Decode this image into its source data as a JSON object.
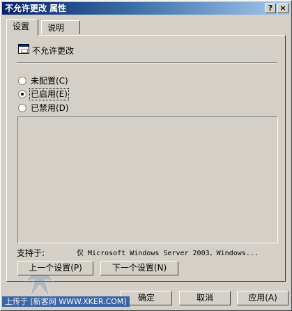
{
  "window": {
    "title": "不允许更改 属性",
    "help_glyph": "?",
    "close_glyph": "×"
  },
  "tabs": [
    {
      "label": "设置"
    },
    {
      "label": "说明"
    }
  ],
  "policy": {
    "name": "不允许更改"
  },
  "options": [
    {
      "label": "未配置(C)",
      "checked": false
    },
    {
      "label": "已启用(E)",
      "checked": true
    },
    {
      "label": "已禁用(D)",
      "checked": false
    }
  ],
  "supported": {
    "label": "支持于:",
    "value": "仅 Microsoft Windows Server 2003、Windows..."
  },
  "nav": {
    "prev": "上一个设置(P)",
    "next": "下一个设置(N)"
  },
  "footer": {
    "ok": "确定",
    "cancel": "取消",
    "apply": "应用(A)"
  },
  "watermark": {
    "text": "上传于 [新客网 WWW.XKER.COM]"
  }
}
